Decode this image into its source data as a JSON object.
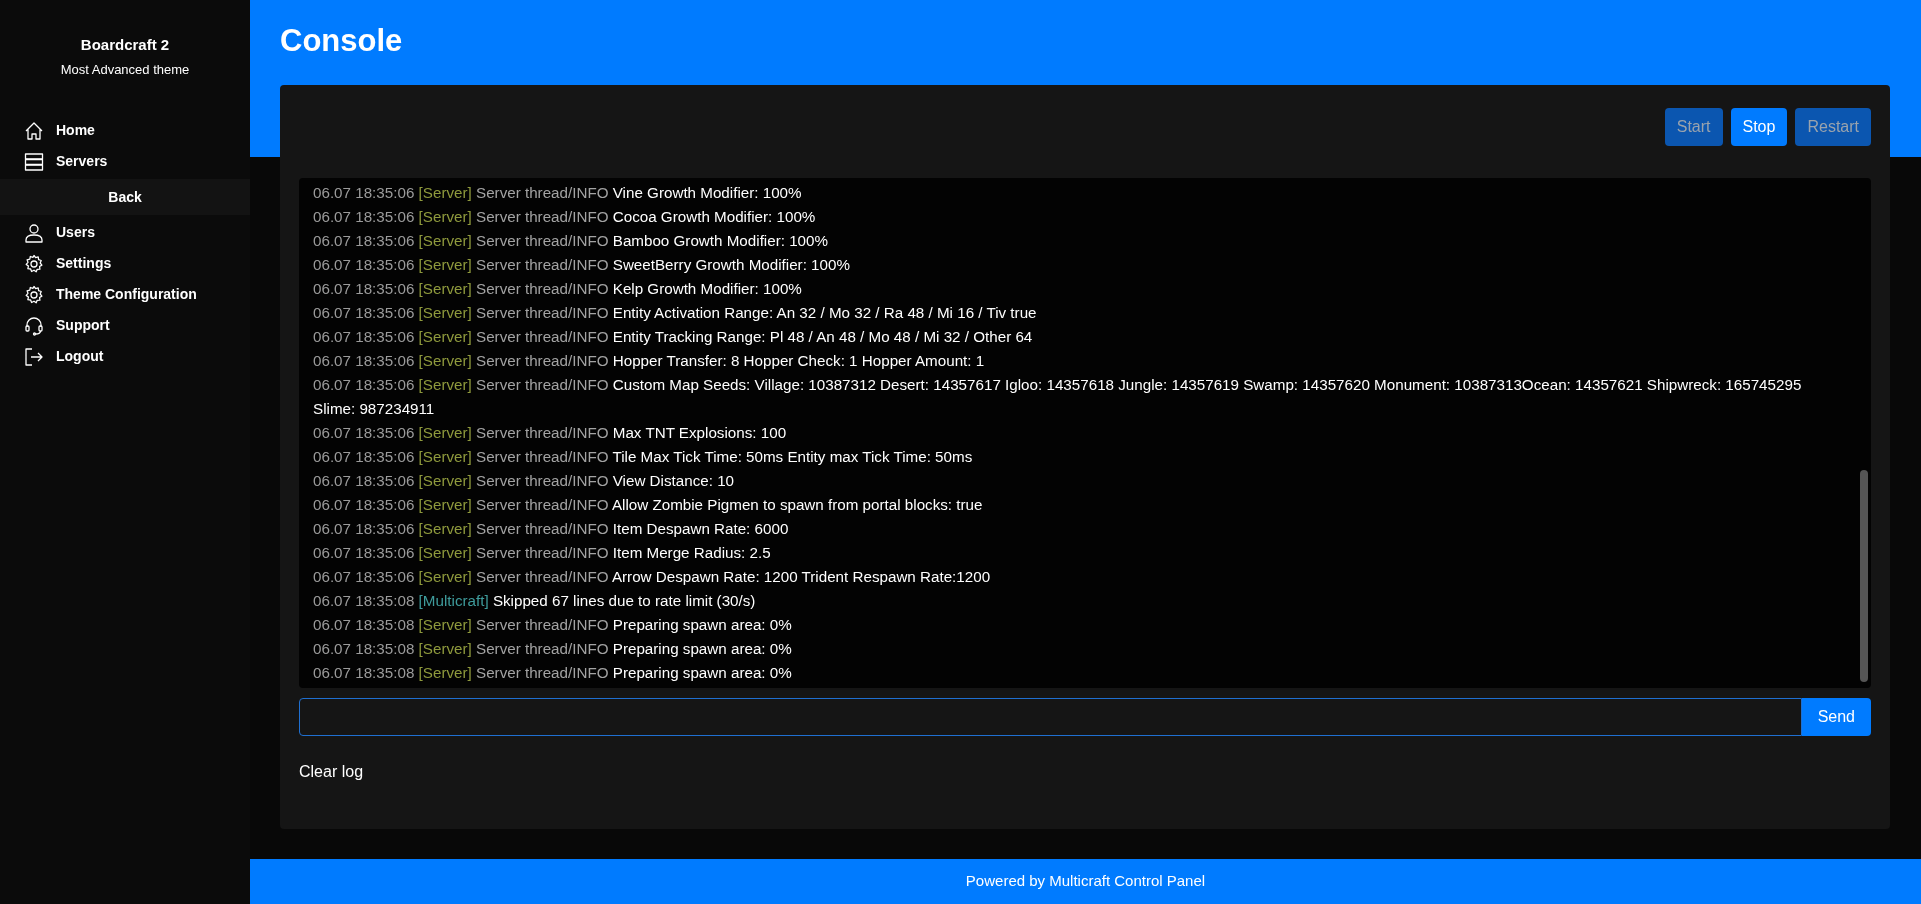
{
  "sidebar": {
    "brand": "Boardcraft 2",
    "subtitle": "Most Advanced theme",
    "items": [
      {
        "label": "Home",
        "kind": "link"
      },
      {
        "label": "Servers",
        "kind": "link"
      },
      {
        "label": "Back",
        "kind": "back"
      },
      {
        "label": "Users",
        "kind": "link"
      },
      {
        "label": "Settings",
        "kind": "link"
      },
      {
        "label": "Theme Configuration",
        "kind": "link"
      },
      {
        "label": "Support",
        "kind": "link"
      },
      {
        "label": "Logout",
        "kind": "link"
      }
    ]
  },
  "page_title": "Console",
  "controls": [
    {
      "label": "Start",
      "disabled": true
    },
    {
      "label": "Stop",
      "disabled": false
    },
    {
      "label": "Restart",
      "disabled": true
    }
  ],
  "log": [
    {
      "time": "06.07 18:35:06",
      "source": "[Server]",
      "kind": "server",
      "thread": "Server thread/INFO",
      "message": "Vine Growth Modifier: 100%"
    },
    {
      "time": "06.07 18:35:06",
      "source": "[Server]",
      "kind": "server",
      "thread": "Server thread/INFO",
      "message": "Cocoa Growth Modifier: 100%"
    },
    {
      "time": "06.07 18:35:06",
      "source": "[Server]",
      "kind": "server",
      "thread": "Server thread/INFO",
      "message": "Bamboo Growth Modifier: 100%"
    },
    {
      "time": "06.07 18:35:06",
      "source": "[Server]",
      "kind": "server",
      "thread": "Server thread/INFO",
      "message": "SweetBerry Growth Modifier: 100%"
    },
    {
      "time": "06.07 18:35:06",
      "source": "[Server]",
      "kind": "server",
      "thread": "Server thread/INFO",
      "message": "Kelp Growth Modifier: 100%"
    },
    {
      "time": "06.07 18:35:06",
      "source": "[Server]",
      "kind": "server",
      "thread": "Server thread/INFO",
      "message": "Entity Activation Range: An 32 / Mo 32 / Ra 48 / Mi 16 / Tiv true"
    },
    {
      "time": "06.07 18:35:06",
      "source": "[Server]",
      "kind": "server",
      "thread": "Server thread/INFO",
      "message": "Entity Tracking Range: Pl 48 / An 48 / Mo 48 / Mi 32 / Other 64"
    },
    {
      "time": "06.07 18:35:06",
      "source": "[Server]",
      "kind": "server",
      "thread": "Server thread/INFO",
      "message": "Hopper Transfer: 8 Hopper Check: 1 Hopper Amount: 1"
    },
    {
      "time": "06.07 18:35:06",
      "source": "[Server]",
      "kind": "server",
      "thread": "Server thread/INFO",
      "message": "Custom Map Seeds: Village: 10387312 Desert: 14357617 Igloo: 14357618 Jungle: 14357619 Swamp: 14357620 Monument: 10387313Ocean: 14357621 Shipwreck: 165745295 Slime: 987234911"
    },
    {
      "time": "06.07 18:35:06",
      "source": "[Server]",
      "kind": "server",
      "thread": "Server thread/INFO",
      "message": "Max TNT Explosions: 100"
    },
    {
      "time": "06.07 18:35:06",
      "source": "[Server]",
      "kind": "server",
      "thread": "Server thread/INFO",
      "message": "Tile Max Tick Time: 50ms Entity max Tick Time: 50ms"
    },
    {
      "time": "06.07 18:35:06",
      "source": "[Server]",
      "kind": "server",
      "thread": "Server thread/INFO",
      "message": "View Distance: 10"
    },
    {
      "time": "06.07 18:35:06",
      "source": "[Server]",
      "kind": "server",
      "thread": "Server thread/INFO",
      "message": "Allow Zombie Pigmen to spawn from portal blocks: true"
    },
    {
      "time": "06.07 18:35:06",
      "source": "[Server]",
      "kind": "server",
      "thread": "Server thread/INFO",
      "message": "Item Despawn Rate: 6000"
    },
    {
      "time": "06.07 18:35:06",
      "source": "[Server]",
      "kind": "server",
      "thread": "Server thread/INFO",
      "message": "Item Merge Radius: 2.5"
    },
    {
      "time": "06.07 18:35:06",
      "source": "[Server]",
      "kind": "server",
      "thread": "Server thread/INFO",
      "message": "Arrow Despawn Rate: 1200 Trident Respawn Rate:1200"
    },
    {
      "time": "06.07 18:35:08",
      "source": "[Multicraft]",
      "kind": "multicraft",
      "message": "Skipped 67 lines due to rate limit (30/s)"
    },
    {
      "time": "06.07 18:35:08",
      "source": "[Server]",
      "kind": "server",
      "thread": "Server thread/INFO",
      "message": "Preparing spawn area: 0%"
    },
    {
      "time": "06.07 18:35:08",
      "source": "[Server]",
      "kind": "server",
      "thread": "Server thread/INFO",
      "message": "Preparing spawn area: 0%"
    },
    {
      "time": "06.07 18:35:08",
      "source": "[Server]",
      "kind": "server",
      "thread": "Server thread/INFO",
      "message": "Preparing spawn area: 0%"
    }
  ],
  "send_button": "Send",
  "clear_log": "Clear log",
  "footer": "Powered by Multicraft Control Panel"
}
